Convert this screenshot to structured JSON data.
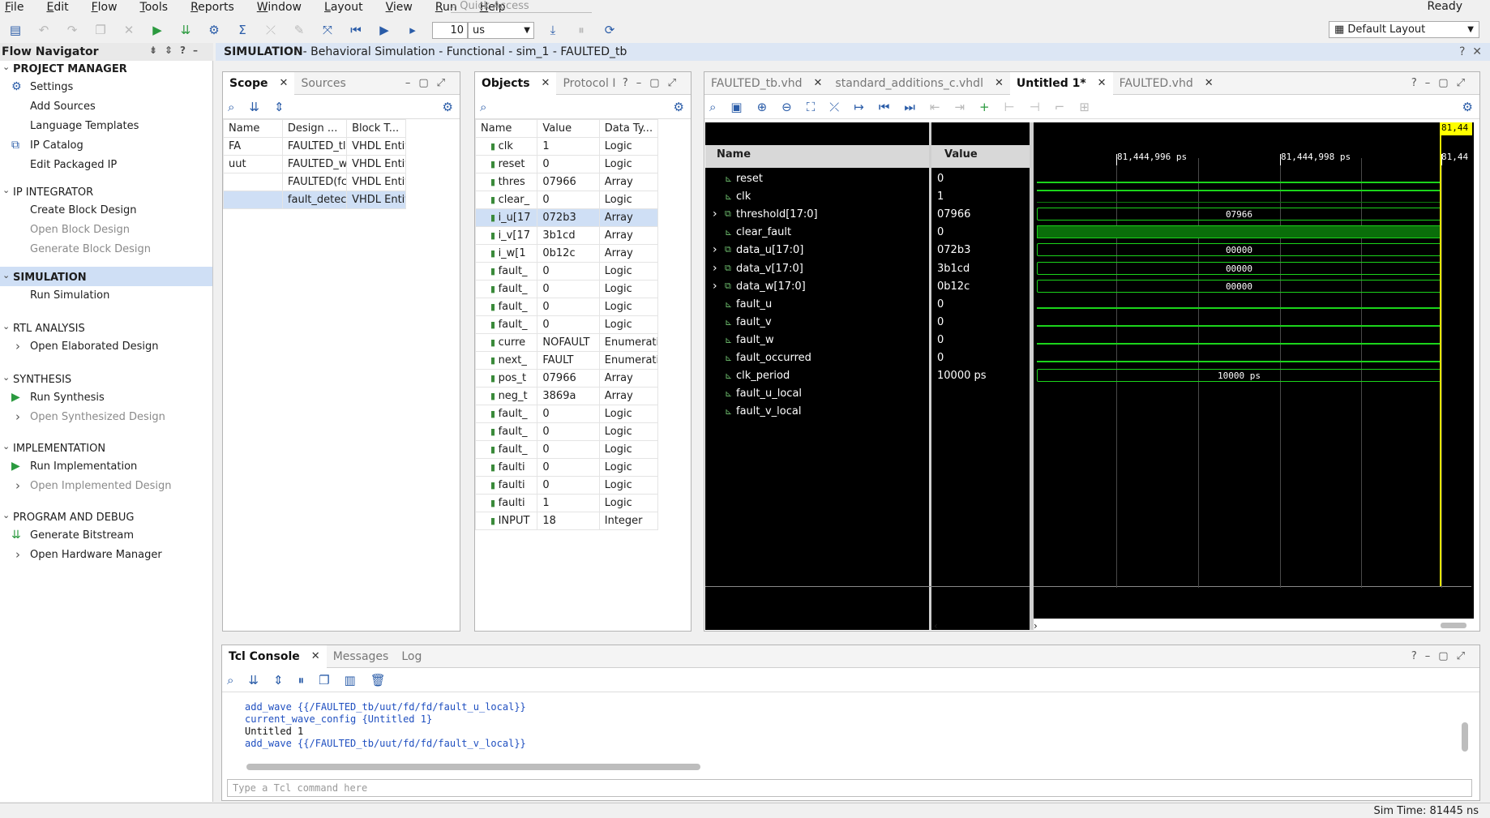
{
  "menu": [
    "File",
    "Edit",
    "Flow",
    "Tools",
    "Reports",
    "Window",
    "Layout",
    "View",
    "Run",
    "Help"
  ],
  "quick_access": "Quick Access",
  "status_ready": "Ready",
  "run_time": {
    "value": "10",
    "unit": "us"
  },
  "layout_select": "Default Layout",
  "flow_nav": {
    "title": "Flow Navigator",
    "sections": [
      {
        "title": "PROJECT MANAGER",
        "items": [
          "Settings",
          "Add Sources",
          "Language Templates",
          "IP Catalog",
          "Edit Packaged IP"
        ]
      },
      {
        "title": "IP INTEGRATOR",
        "items": [
          "Create Block Design",
          "Open Block Design",
          "Generate Block Design"
        ]
      },
      {
        "title": "SIMULATION",
        "items": [
          "Run Simulation"
        ]
      },
      {
        "title": "RTL ANALYSIS",
        "items": [
          "Open Elaborated Design"
        ]
      },
      {
        "title": "SYNTHESIS",
        "items": [
          "Run Synthesis",
          "Open Synthesized Design"
        ]
      },
      {
        "title": "IMPLEMENTATION",
        "items": [
          "Run Implementation",
          "Open Implemented Design"
        ]
      },
      {
        "title": "PROGRAM AND DEBUG",
        "items": [
          "Generate Bitstream",
          "Open Hardware Manager"
        ]
      }
    ]
  },
  "sim_header": {
    "bold": "SIMULATION",
    "rest": " - Behavioral Simulation - Functional - sim_1 - FAULTED_tb"
  },
  "scope": {
    "tabs": [
      "Scope",
      "Sources"
    ],
    "headers": [
      "Name",
      "Design ...",
      "Block T..."
    ],
    "rows": [
      [
        "FA",
        "FAULTED_tl",
        "VHDL Entity"
      ],
      [
        "uut",
        "FAULTED_w",
        "VHDL Entity"
      ],
      [
        "",
        "FAULTED(fc",
        "VHDL Entity"
      ],
      [
        "",
        "fault_detec",
        "VHDL Entity"
      ]
    ]
  },
  "objects": {
    "tabs": [
      "Objects",
      "Protocol I"
    ],
    "headers": [
      "Name",
      "Value",
      "Data Ty..."
    ],
    "rows": [
      [
        "clk",
        "1",
        "Logic"
      ],
      [
        "reset",
        "0",
        "Logic"
      ],
      [
        "thres",
        "07966",
        "Array"
      ],
      [
        "clear_",
        "0",
        "Logic"
      ],
      [
        "i_u[17",
        "072b3",
        "Array"
      ],
      [
        "i_v[17",
        "3b1cd",
        "Array"
      ],
      [
        "i_w[1",
        "0b12c",
        "Array"
      ],
      [
        "fault_",
        "0",
        "Logic"
      ],
      [
        "fault_",
        "0",
        "Logic"
      ],
      [
        "fault_",
        "0",
        "Logic"
      ],
      [
        "fault_",
        "0",
        "Logic"
      ],
      [
        "curre",
        "NOFAULT",
        "Enumeratic"
      ],
      [
        "next_",
        "FAULT",
        "Enumeratic"
      ],
      [
        "pos_t",
        "07966",
        "Array"
      ],
      [
        "neg_t",
        "3869a",
        "Array"
      ],
      [
        "fault_",
        "0",
        "Logic"
      ],
      [
        "fault_",
        "0",
        "Logic"
      ],
      [
        "fault_",
        "0",
        "Logic"
      ],
      [
        "faulti",
        "0",
        "Logic"
      ],
      [
        "faulti",
        "0",
        "Logic"
      ],
      [
        "faulti",
        "1",
        "Logic"
      ],
      [
        "INPUT",
        "18",
        "Integer"
      ]
    ]
  },
  "wave": {
    "tabs": [
      "FAULTED_tb.vhd",
      "standard_additions_c.vhdl",
      "Untitled 1*",
      "FAULTED.vhd"
    ],
    "col_name": "Name",
    "col_value": "Value",
    "times": [
      "81,444,996 ps",
      "81,444,998 ps",
      "81,44"
    ],
    "cursor_label": "81,44",
    "signals": [
      {
        "name": "reset",
        "value": "0",
        "kind": "low"
      },
      {
        "name": "clk",
        "value": "1",
        "kind": "high"
      },
      {
        "name": "threshold[17:0]",
        "value": "07966",
        "kind": "bus",
        "bus": "07966"
      },
      {
        "name": "clear_fault",
        "value": "0",
        "kind": "fill"
      },
      {
        "name": "data_u[17:0]",
        "value": "072b3",
        "kind": "bus",
        "bus": "00000"
      },
      {
        "name": "data_v[17:0]",
        "value": "3b1cd",
        "kind": "bus",
        "bus": "00000"
      },
      {
        "name": "data_w[17:0]",
        "value": "0b12c",
        "kind": "bus",
        "bus": "00000"
      },
      {
        "name": "fault_u",
        "value": "0",
        "kind": "low"
      },
      {
        "name": "fault_v",
        "value": "0",
        "kind": "low"
      },
      {
        "name": "fault_w",
        "value": "0",
        "kind": "low"
      },
      {
        "name": "fault_occurred",
        "value": "0",
        "kind": "low"
      },
      {
        "name": "clk_period",
        "value": "10000 ps",
        "kind": "bus",
        "bus": "10000 ps"
      },
      {
        "name": "fault_u_local",
        "value": "",
        "kind": "none"
      },
      {
        "name": "fault_v_local",
        "value": "",
        "kind": "none"
      }
    ]
  },
  "console": {
    "tabs": [
      "Tcl Console",
      "Messages",
      "Log"
    ],
    "lines": [
      "add_wave {{/FAULTED_tb/uut/fd/fd/fault_u_local}}",
      "current_wave_config {Untitled 1}",
      "Untitled 1",
      "add_wave {{/FAULTED_tb/uut/fd/fd/fault_v_local}}"
    ],
    "placeholder": "Type a Tcl command here"
  },
  "sim_time": "Sim Time: 81445 ns"
}
